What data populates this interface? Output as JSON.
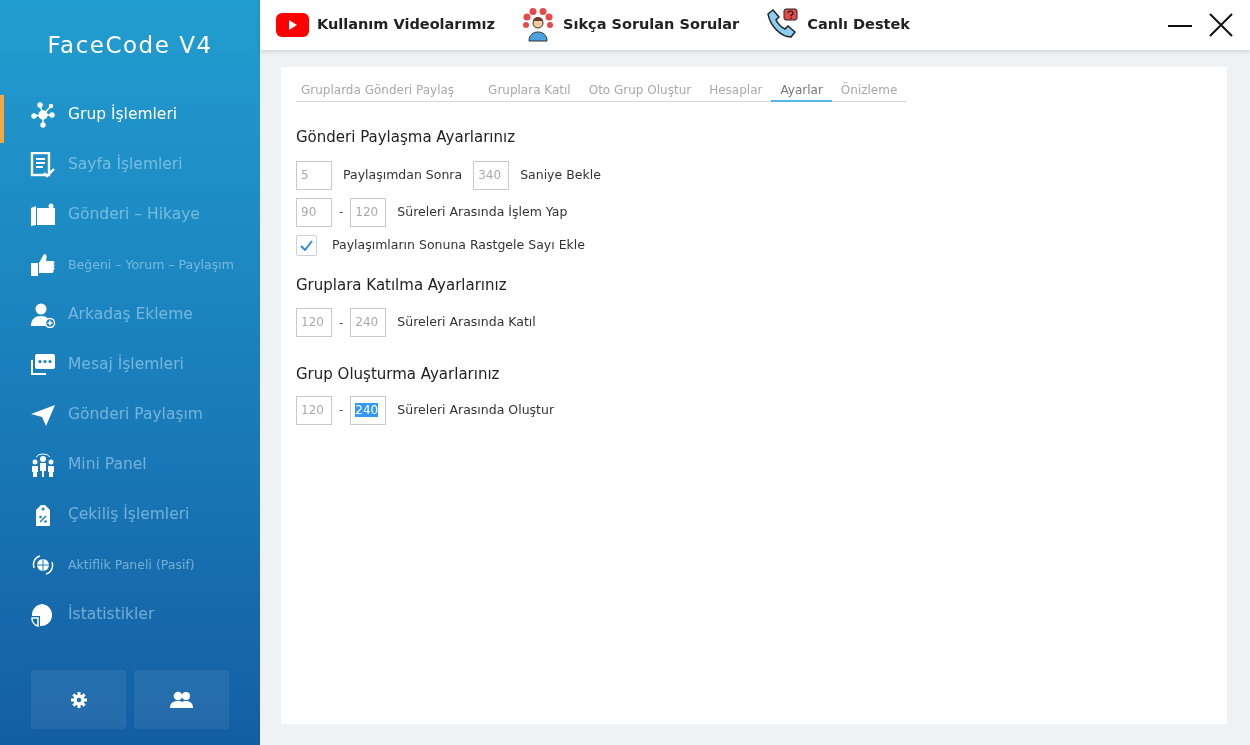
{
  "sidebar": {
    "title": "FaceCode V4",
    "items": [
      {
        "label": "Grup İşlemleri",
        "selected": true
      },
      {
        "label": "Sayfa İşlemleri",
        "selected": false
      },
      {
        "label": "Gönderi – Hikaye",
        "selected": false
      },
      {
        "label": "Beğeni – Yorum – Paylaşım",
        "selected": false
      },
      {
        "label": "Arkadaş Ekleme",
        "selected": false
      },
      {
        "label": "Mesaj İşlemleri",
        "selected": false
      },
      {
        "label": "Gönderi Paylaşım",
        "selected": false
      },
      {
        "label": "Mini Panel",
        "selected": false
      },
      {
        "label": "Çekiliş İşlemleri",
        "selected": false
      },
      {
        "label": "Aktiflik Paneli (Pasif)",
        "selected": false
      },
      {
        "label": "İstatistikler",
        "selected": false
      }
    ]
  },
  "top_links": [
    "Kullanım Videolarımız",
    "Sıkça Sorulan Sorular",
    "Canlı Destek"
  ],
  "tabs": [
    {
      "label": "Gruplarda Gönderi Paylaş",
      "selected": false
    },
    {
      "label": "Gruplara Katıl",
      "selected": false
    },
    {
      "label": "Oto Grup Oluştur",
      "selected": false
    },
    {
      "label": "Hesaplar",
      "selected": false
    },
    {
      "label": "Ayarlar",
      "selected": true
    },
    {
      "label": "Önizleme",
      "selected": false
    }
  ],
  "sections": [
    {
      "title": "Gönderi Paylaşma Ayarlarınız",
      "rows": [
        {
          "kind": "wait",
          "count": {
            "value": "5",
            "highlighted": false
          },
          "count_label": "Paylaşımdan Sonra",
          "seconds": {
            "value": "340",
            "highlighted": false
          },
          "seconds_label": "Saniye Bekle"
        },
        {
          "kind": "range",
          "min": {
            "value": "90",
            "highlighted": false
          },
          "dash": "-",
          "max": {
            "value": "120",
            "highlighted": false
          },
          "label": "Süreleri Arasında İşlem Yap"
        },
        {
          "kind": "checkbox",
          "checked": true,
          "label": "Paylaşımların Sonuna Rastgele Sayı Ekle"
        }
      ]
    },
    {
      "title": "Gruplara Katılma Ayarlarınız",
      "rows": [
        {
          "kind": "range",
          "min": {
            "value": "120",
            "highlighted": false
          },
          "dash": "-",
          "max": {
            "value": "240",
            "highlighted": false
          },
          "label": "Süreleri Arasında Katıl"
        }
      ]
    },
    {
      "title": "Grup Oluşturma Ayarlarınız",
      "rows": [
        {
          "kind": "range",
          "min": {
            "value": "120",
            "highlighted": false
          },
          "dash": "-",
          "max": {
            "value": "240",
            "highlighted": true
          },
          "label": "Süreleri Arasında Oluştur"
        }
      ]
    }
  ]
}
